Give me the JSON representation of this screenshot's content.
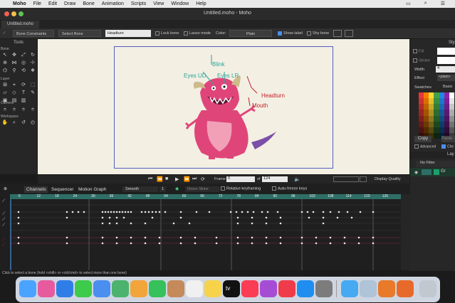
{
  "menubar": {
    "apple": "",
    "app": "Moho",
    "items": [
      "File",
      "Edit",
      "Draw",
      "Bone",
      "Animation",
      "Scripts",
      "View",
      "Window",
      "Help"
    ]
  },
  "window": {
    "title": "Untitled.moho - Moho"
  },
  "doc_tab": "Untitled.moho",
  "options": {
    "bone_constraints": "Bone Constraints",
    "select_bone": "Select Bone",
    "bone_name": "Headturn",
    "lock_bone": "Lock bone",
    "lasso_mode": "Lasso mode",
    "color_label": "Color:",
    "color_value": "Plain",
    "show_label": "Show label",
    "shy_bone": "Shy bone"
  },
  "tools": {
    "header": "Tools",
    "sections": [
      "Bone",
      "Layer",
      "Camera",
      "Workspace"
    ]
  },
  "canvas": {
    "labels": [
      "Blink",
      "Eyes UD",
      "Eyes LR",
      "Headturn",
      "Mouth"
    ],
    "colors": {
      "bone_label": "#2aa59a",
      "selected_label": "#c02028",
      "body": "#e0457a",
      "horn": "#cdbb8a"
    }
  },
  "right_panel": {
    "header": "Sty",
    "fill": "Fill",
    "stroke": "Stroke",
    "width_label": "Width",
    "width_value": "4",
    "effect_label": "Effect",
    "effect_value": "<plain>",
    "swatches_label": "Swatches",
    "swatches_value": "Basic",
    "copy": "Copy",
    "paste": "Paste",
    "advanced": "Advanced",
    "che": "Che",
    "layers_header": "Lay",
    "no_filter": "No Filter",
    "layer_name": "Gr"
  },
  "playback": {
    "frame_label": "Frame",
    "frame_value": "0",
    "of_label": "of",
    "total": "124",
    "display_quality": "Display Quality"
  },
  "timeline": {
    "tabs": [
      "Channels",
      "Sequencer",
      "Motion Graph"
    ],
    "interp": "Smooth",
    "interp_value": "1",
    "onion_skins": "Onion Skins",
    "relative_keyframing": "Relative keyframing",
    "auto_freeze": "Auto-freeze keys",
    "ruler_marks": [
      "6",
      "12",
      "18",
      "24",
      "30",
      "36",
      "42",
      "48",
      "54",
      "60",
      "66",
      "72",
      "78",
      "84",
      "90",
      "96",
      "102",
      "108",
      "114",
      "120",
      "126"
    ],
    "section_marks": [
      "1",
      "2",
      "3",
      "4",
      "5"
    ]
  },
  "status": "Click to select a bone (hold <shift> or <ctrl/cmd> to select more than one bone)",
  "dock": {
    "apps": [
      "finder-icon",
      "launchpad-icon",
      "safari-icon",
      "messages-icon",
      "mail-icon",
      "maps-icon",
      "photos-icon",
      "facetime-icon",
      "contacts-icon",
      "reminders-icon",
      "notes-icon",
      "tv-icon",
      "music-icon",
      "podcasts-icon",
      "news-icon",
      "appstore-icon",
      "settings-icon",
      "altool-icon",
      "preview-icon",
      "moho-icon",
      "moho2-icon",
      "trash-icon"
    ],
    "tv_label": "tv"
  }
}
